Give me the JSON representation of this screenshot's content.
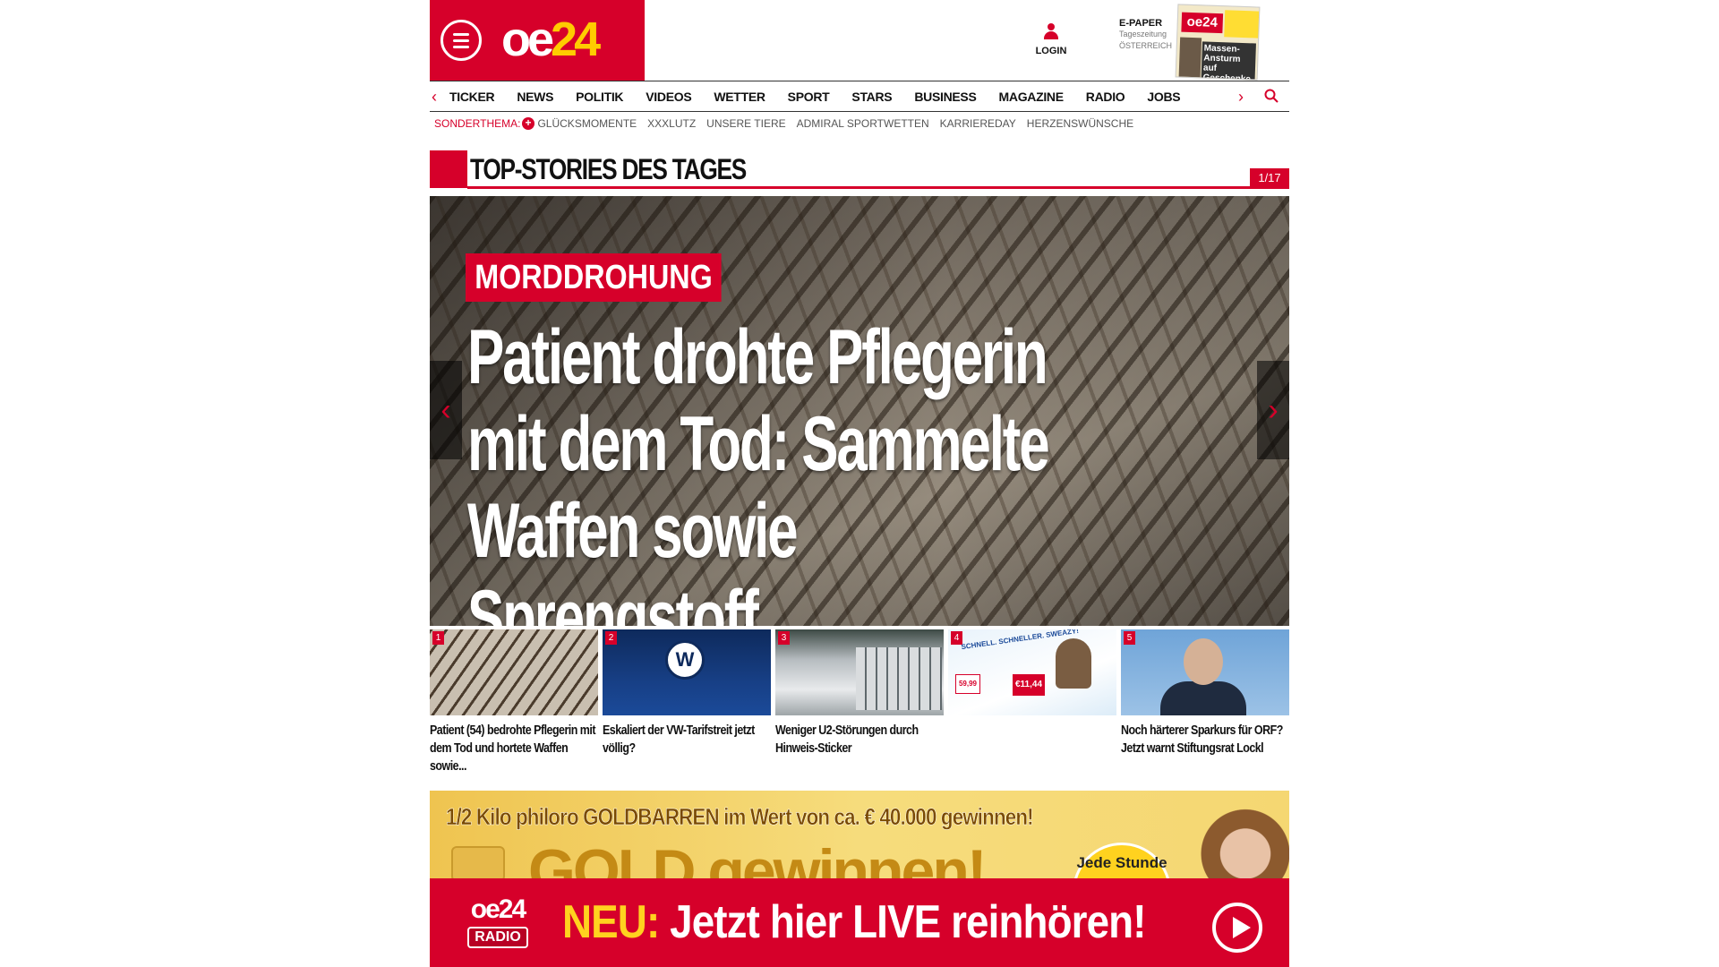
{
  "header": {
    "logo_main": "oe",
    "logo_accent": "24",
    "login_label": "LOGIN",
    "epaper": {
      "title": "E-PAPER",
      "line1": "Tageszeitung",
      "line2": "ÖSTERREICH"
    },
    "cover": {
      "logo": "oe24",
      "headline": "Massen-Ansturm auf Geschenke"
    }
  },
  "nav": {
    "items": [
      "TICKER",
      "NEWS",
      "POLITIK",
      "VIDEOS",
      "WETTER",
      "SPORT",
      "STARS",
      "BUSINESS",
      "MAGAZINE",
      "RADIO",
      "JOBS"
    ]
  },
  "subnav": {
    "label": "SONDERTHEMA:",
    "items": [
      "GLÜCKSMOMENTE",
      "XXXLUTZ",
      "UNSERE TIERE",
      "ADMIRAL SPORTWETTEN",
      "KARRIEREDAY",
      "HERZENSWÜNSCHE"
    ]
  },
  "top_stories": {
    "title": "TOP-STORIES DES TAGES",
    "counter": "1/17"
  },
  "hero": {
    "kicker": "MORDDROHUNG",
    "headline": "Patient drohte Pflegerin mit dem Tod: Sammelte Waffen sowie Sprengstoff"
  },
  "thumbs": [
    {
      "num": "1",
      "caption": "Patient (54) bedrohte Pflegerin mit dem Tod und hortete Waffen sowie..."
    },
    {
      "num": "2",
      "caption": "Eskaliert der VW-Tarifstreit jetzt völlig?"
    },
    {
      "num": "3",
      "caption": "Weniger U2-Störungen durch Hinweis-Sticker"
    },
    {
      "num": "4",
      "caption": "",
      "ad_text": "SCHNELL. SCHNELLER. SWEAZY!",
      "price_left": "59,99",
      "price_right": "€11,44"
    },
    {
      "num": "5",
      "caption": "Noch härterer Sparkurs für ORF? Jetzt warnt Stiftungsrat Lockl"
    }
  ],
  "ad_banner": {
    "headline": "1/2 Kilo philoro GOLDBARREN im Wert von ca. € 40.000 gewinnen!",
    "big_text": "GOLD gewinnen!",
    "badge": "Jede Stunde"
  },
  "radio_bar": {
    "logo": "oe24",
    "logo_sub": "RADIO",
    "neu": "NEU:",
    "text": " Jetzt hier LIVE reinhören!"
  },
  "colors": {
    "brand_red": "#d6002a",
    "brand_yellow": "#ffcc00"
  }
}
